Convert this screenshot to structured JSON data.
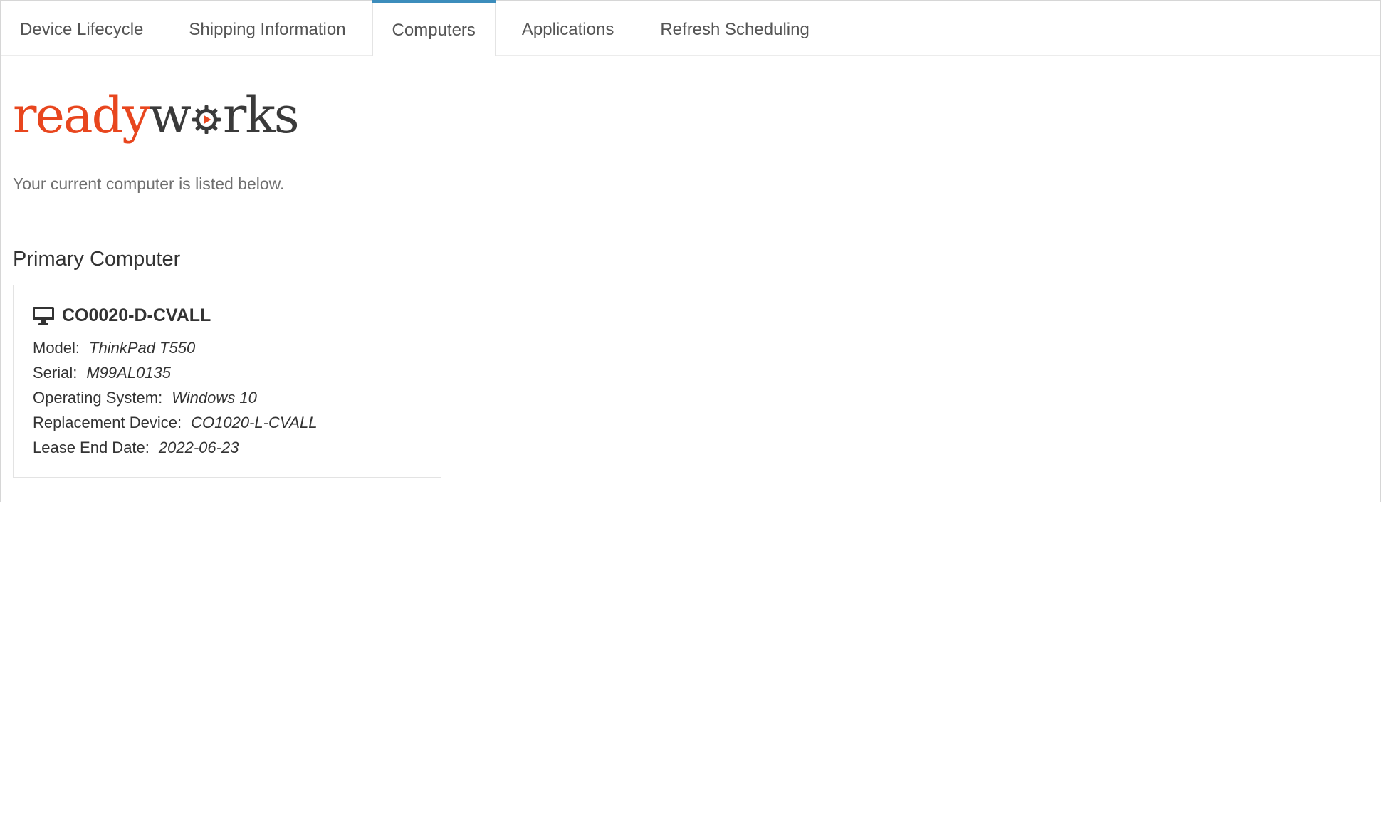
{
  "tabs": [
    {
      "label": "Device Lifecycle",
      "active": false
    },
    {
      "label": "Shipping Information",
      "active": false
    },
    {
      "label": "Computers",
      "active": true
    },
    {
      "label": "Applications",
      "active": false
    },
    {
      "label": "Refresh Scheduling",
      "active": false
    }
  ],
  "logo": {
    "part1": "ready",
    "part2_a": "w",
    "part2_b": "rks",
    "icon": "gear-play-icon"
  },
  "intro_text": "Your current computer is listed below.",
  "section_title": "Primary Computer",
  "computer": {
    "icon": "monitor-icon",
    "name": "CO0020-D-CVALL",
    "fields": [
      {
        "label": "Model:",
        "value": "ThinkPad T550"
      },
      {
        "label": "Serial:",
        "value": "M99AL0135"
      },
      {
        "label": "Operating System:",
        "value": "Windows 10"
      },
      {
        "label": "Replacement Device:",
        "value": "CO1020-L-CVALL"
      },
      {
        "label": "Lease End Date:",
        "value": "2022-06-23"
      }
    ]
  },
  "colors": {
    "accent": "#3c8dbc",
    "brand_orange": "#e8461e",
    "brand_dark": "#3a3a3a"
  }
}
